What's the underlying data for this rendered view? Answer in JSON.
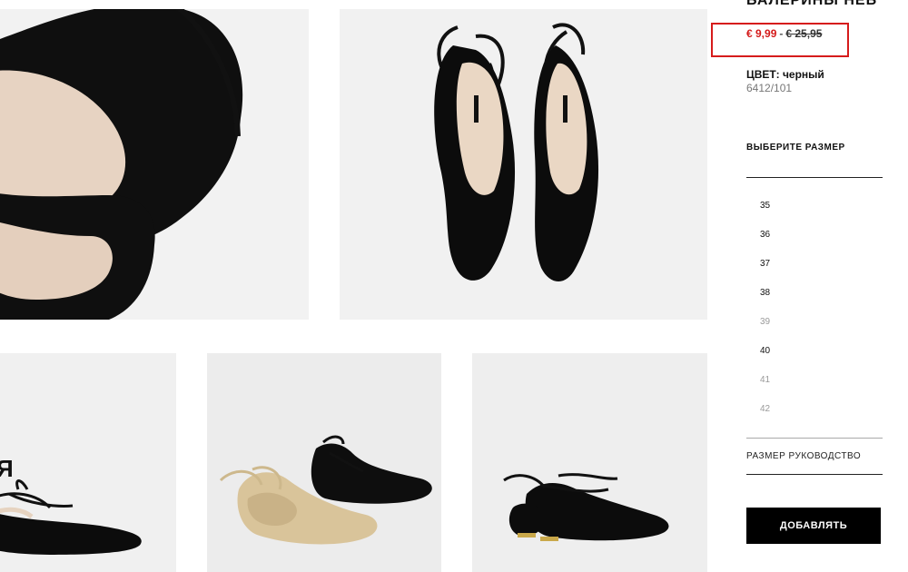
{
  "product": {
    "title": "БАЛЕРИНЫ НЕБ",
    "price_sale": "€ 9,99",
    "price_sep": "-",
    "price_old": "€ 25,95",
    "color_label": "ЦВЕТ: черный",
    "code": "6412/101"
  },
  "size_selector": {
    "heading": "ВЫБЕРИТЕ РАЗМЕР",
    "sizes": [
      {
        "label": "35",
        "available": true
      },
      {
        "label": "36",
        "available": true
      },
      {
        "label": "37",
        "available": true
      },
      {
        "label": "38",
        "available": true
      },
      {
        "label": "39",
        "available": false
      },
      {
        "label": "40",
        "available": true
      },
      {
        "label": "41",
        "available": false
      },
      {
        "label": "42",
        "available": false
      }
    ],
    "guide_label": "РАЗМЕР РУКОВОДСТВО"
  },
  "actions": {
    "add_label": "ДОБАВЛЯТЬ"
  },
  "gallery": {
    "overlay_text": "Я",
    "images": [
      "black-ballerina-pointed-toe-closeup",
      "black-lace-up-ballerinas-top-view",
      "black-lace-up-ballerina-side",
      "gold-and-black-lace-up-ballerinas-pair",
      "black-lace-up-ballerina-gold-heel"
    ]
  },
  "colors": {
    "highlight": "#d61b1b",
    "sale": "#d41a1a",
    "button_bg": "#000000",
    "button_text": "#ffffff"
  }
}
